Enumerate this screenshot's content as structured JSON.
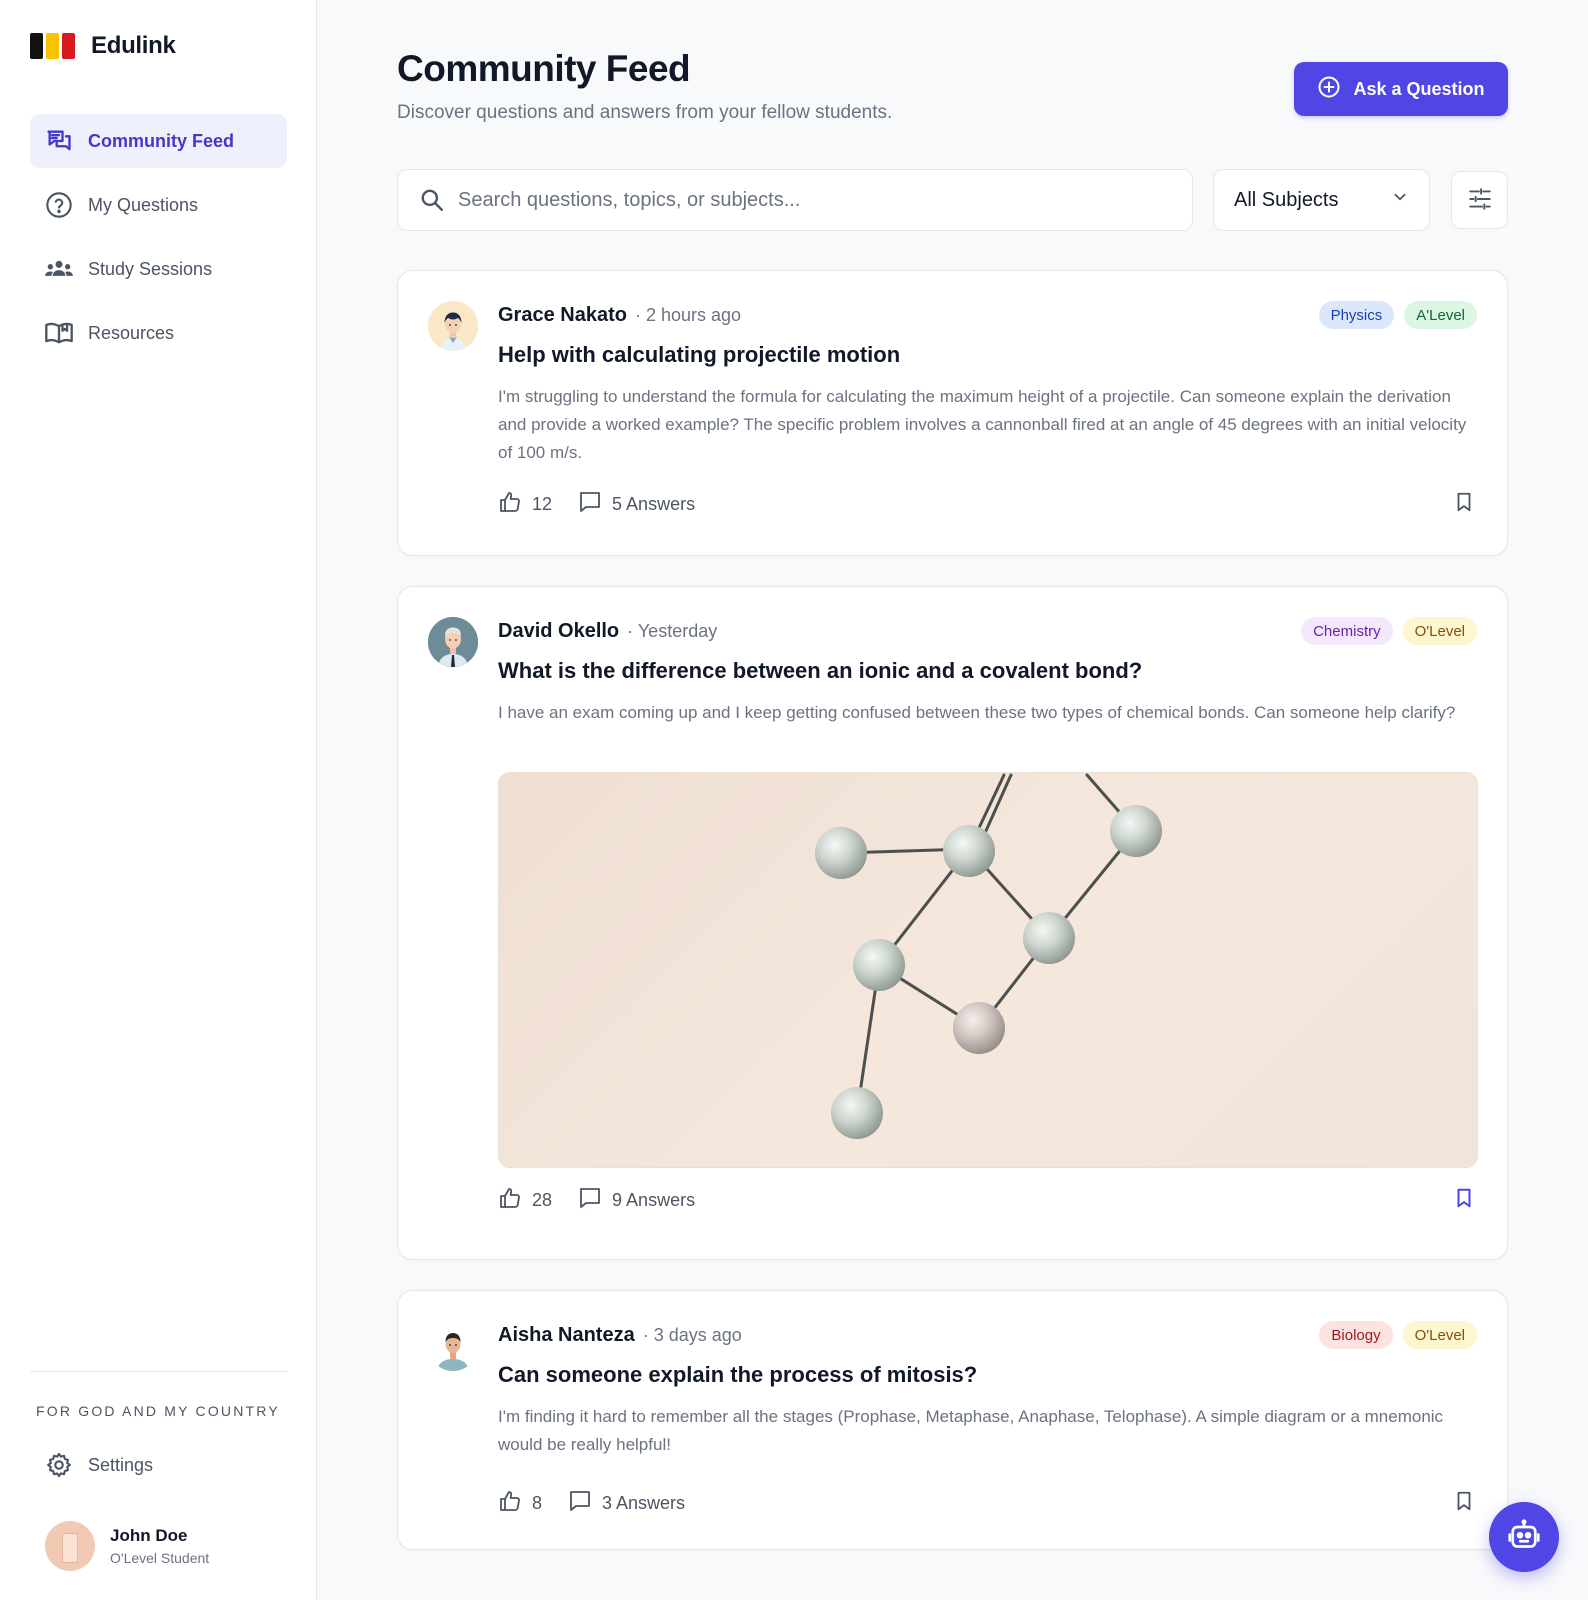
{
  "app": {
    "name": "Edulink"
  },
  "sidebar": {
    "items": [
      {
        "label": "Community Feed",
        "icon": "chat-bubbles-icon",
        "active": true
      },
      {
        "label": "My Questions",
        "icon": "question-circle-icon",
        "active": false
      },
      {
        "label": "Study Sessions",
        "icon": "users-group-icon",
        "active": false
      },
      {
        "label": "Resources",
        "icon": "book-open-icon",
        "active": false
      }
    ],
    "motto": "FOR GOD AND MY COUNTRY",
    "settings_label": "Settings",
    "user": {
      "name": "John Doe",
      "role": "O'Level Student"
    }
  },
  "header": {
    "title": "Community Feed",
    "subtitle": "Discover questions and answers from your fellow students.",
    "ask_label": "Ask a Question"
  },
  "search": {
    "placeholder": "Search questions, topics, or subjects...",
    "value": ""
  },
  "filter": {
    "selected": "All Subjects"
  },
  "posts": [
    {
      "author": "Grace Nakato",
      "time": "· 2 hours ago",
      "tags": [
        {
          "label": "Physics",
          "bg": "#dbe8fb",
          "fg": "#1e40af"
        },
        {
          "label": "A'Level",
          "bg": "#dcf6e4",
          "fg": "#166534"
        }
      ],
      "title": "Help with calculating projectile motion",
      "body": "I'm struggling to understand the formula for calculating the maximum height of a projectile. Can someone explain the derivation and provide a worked example? The specific problem involves a cannonball fired at an angle of 45 degrees with an initial velocity of 100 m/s.",
      "likes": "12",
      "answers": "5 Answers",
      "bookmarked": false
    },
    {
      "author": "David Okello",
      "time": "· Yesterday",
      "tags": [
        {
          "label": "Chemistry",
          "bg": "#f3e8fd",
          "fg": "#6b21a8"
        },
        {
          "label": "O'Level",
          "bg": "#fdf6cf",
          "fg": "#854d0e"
        }
      ],
      "title": "What is the difference between an ionic and a covalent bond?",
      "body": "I have an exam coming up and I keep getting confused between these two types of chemical bonds. Can someone help clarify?",
      "likes": "28",
      "answers": "9 Answers",
      "bookmarked": true
    },
    {
      "author": "Aisha Nanteza",
      "time": "· 3 days ago",
      "tags": [
        {
          "label": "Biology",
          "bg": "#fde2e2",
          "fg": "#991b1b"
        },
        {
          "label": "O'Level",
          "bg": "#fdf6cf",
          "fg": "#854d0e"
        }
      ],
      "title": "Can someone explain the process of mitosis?",
      "body": "I'm finding it hard to remember all the stages (Prophase, Metaphase, Anaphase, Telophase). A simple diagram or a mnemonic would be really helpful!",
      "likes": "8",
      "answers": "3 Answers",
      "bookmarked": false
    }
  ],
  "colors": {
    "accent": "#4f46e5",
    "active_nav_bg": "#eef0fd",
    "background": "#f8f9fb"
  }
}
